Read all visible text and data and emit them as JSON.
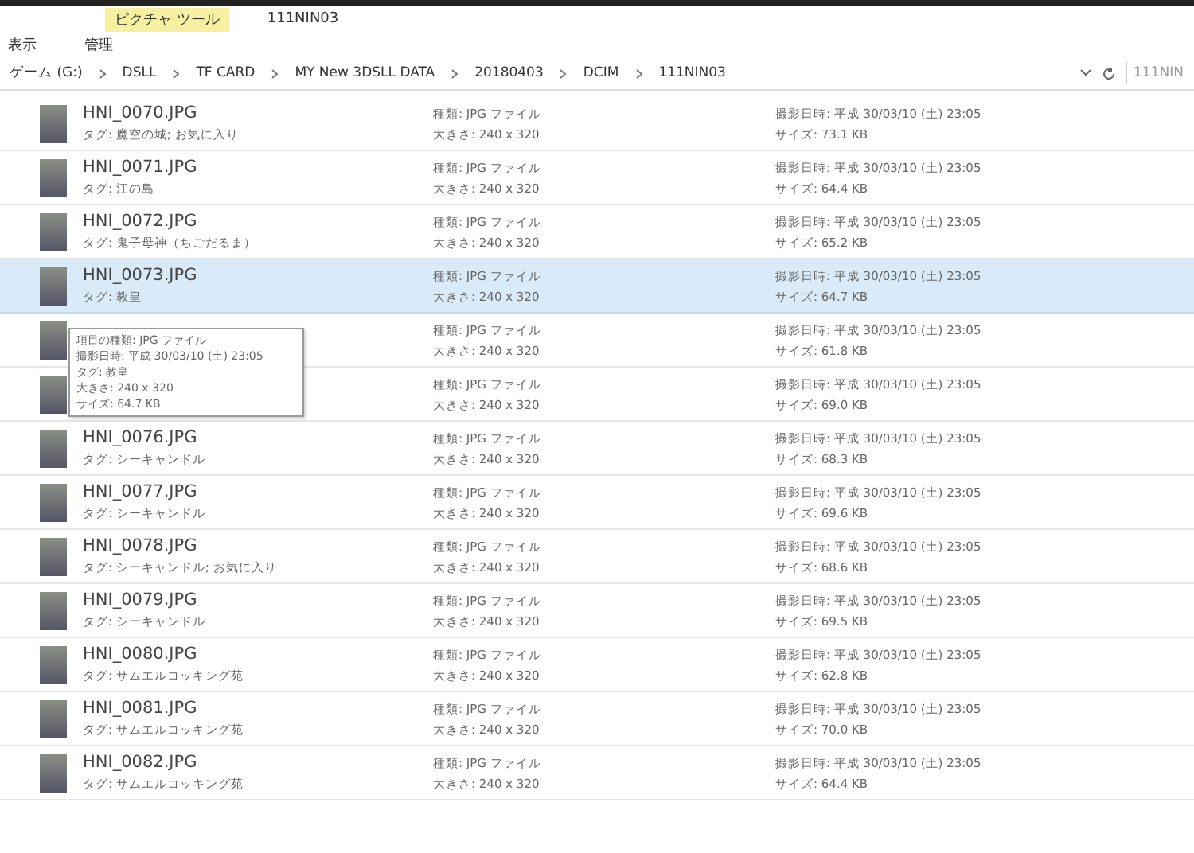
{
  "window": {
    "context_tab": "ピクチャ ツール",
    "title": "111NIN03"
  },
  "ribbon_tabs": [
    {
      "label": "表示",
      "selected": false
    },
    {
      "label": "管理",
      "selected": false
    }
  ],
  "address_bar": {
    "segments": [
      "ゲーム (G:)",
      "DSLL",
      "TF CARD",
      "MY New 3DSLL DATA",
      "20180403",
      "DCIM",
      "111NIN03"
    ],
    "search_value": "111NIN"
  },
  "files": [
    {
      "name": "HNI_0070.JPG",
      "tag": "タグ: 魔空の城; お気に入り",
      "type": "種類: JPG ファイル",
      "dimensions": "大きさ: 240 x 320",
      "date": "撮影日時: 平成 30/03/10 (土) 23:05",
      "size": "サイズ: 73.1 KB",
      "selected": false
    },
    {
      "name": "HNI_0071.JPG",
      "tag": "タグ: 江の島",
      "type": "種類: JPG ファイル",
      "dimensions": "大きさ: 240 x 320",
      "date": "撮影日時: 平成 30/03/10 (土) 23:05",
      "size": "サイズ: 64.4 KB",
      "selected": false
    },
    {
      "name": "HNI_0072.JPG",
      "tag": "タグ: 鬼子母神（ちごだるま）",
      "type": "種類: JPG ファイル",
      "dimensions": "大きさ: 240 x 320",
      "date": "撮影日時: 平成 30/03/10 (土) 23:05",
      "size": "サイズ: 65.2 KB",
      "selected": false
    },
    {
      "name": "HNI_0073.JPG",
      "tag": "タグ: 教皇",
      "type": "種類: JPG ファイル",
      "dimensions": "大きさ: 240 x 320",
      "date": "撮影日時: 平成 30/03/10 (土) 23:05",
      "size": "サイズ: 64.7 KB",
      "selected": true
    },
    {
      "type": "種類: JPG ファイル",
      "dimensions": "大きさ: 240 x 320",
      "date": "撮影日時: 平成 30/03/10 (土) 23:05",
      "size": "サイズ: 61.8 KB",
      "selected": false
    },
    {
      "type": "種類: JPG ファイル",
      "dimensions": "大きさ: 240 x 320",
      "date": "撮影日時: 平成 30/03/10 (土) 23:05",
      "size": "サイズ: 69.0 KB",
      "selected": false
    },
    {
      "name": "HNI_0076.JPG",
      "tag": "タグ: シーキャンドル",
      "type": "種類: JPG ファイル",
      "dimensions": "大きさ: 240 x 320",
      "date": "撮影日時: 平成 30/03/10 (土) 23:05",
      "size": "サイズ: 68.3 KB",
      "selected": false
    },
    {
      "name": "HNI_0077.JPG",
      "tag": "タグ: シーキャンドル",
      "type": "種類: JPG ファイル",
      "dimensions": "大きさ: 240 x 320",
      "date": "撮影日時: 平成 30/03/10 (土) 23:05",
      "size": "サイズ: 69.6 KB",
      "selected": false
    },
    {
      "name": "HNI_0078.JPG",
      "tag": "タグ: シーキャンドル; お気に入り",
      "type": "種類: JPG ファイル",
      "dimensions": "大きさ: 240 x 320",
      "date": "撮影日時: 平成 30/03/10 (土) 23:05",
      "size": "サイズ: 68.6 KB",
      "selected": false
    },
    {
      "name": "HNI_0079.JPG",
      "tag": "タグ: シーキャンドル",
      "type": "種類: JPG ファイル",
      "dimensions": "大きさ: 240 x 320",
      "date": "撮影日時: 平成 30/03/10 (土) 23:05",
      "size": "サイズ: 69.5 KB",
      "selected": false
    },
    {
      "name": "HNI_0080.JPG",
      "tag": "タグ: サムエルコッキング苑",
      "type": "種類: JPG ファイル",
      "dimensions": "大きさ: 240 x 320",
      "date": "撮影日時: 平成 30/03/10 (土) 23:05",
      "size": "サイズ: 62.8 KB",
      "selected": false
    },
    {
      "name": "HNI_0081.JPG",
      "tag": "タグ: サムエルコッキング苑",
      "type": "種類: JPG ファイル",
      "dimensions": "大きさ: 240 x 320",
      "date": "撮影日時: 平成 30/03/10 (土) 23:05",
      "size": "サイズ: 70.0 KB",
      "selected": false
    },
    {
      "name": "HNI_0082.JPG",
      "tag": "タグ: サムエルコッキング苑",
      "type": "種類: JPG ファイル",
      "dimensions": "大きさ: 240 x 320",
      "date": "撮影日時: 平成 30/03/10 (土) 23:05",
      "size": "サイズ: 64.4 KB",
      "selected": false
    }
  ],
  "tooltip": {
    "lines": [
      "項目の種類: JPG ファイル",
      "撮影日時: 平成 30/03/10 (土) 23:05",
      "タグ: 教皇",
      "大きさ: 240 x 320",
      "サイズ: 64.7 KB"
    ]
  }
}
